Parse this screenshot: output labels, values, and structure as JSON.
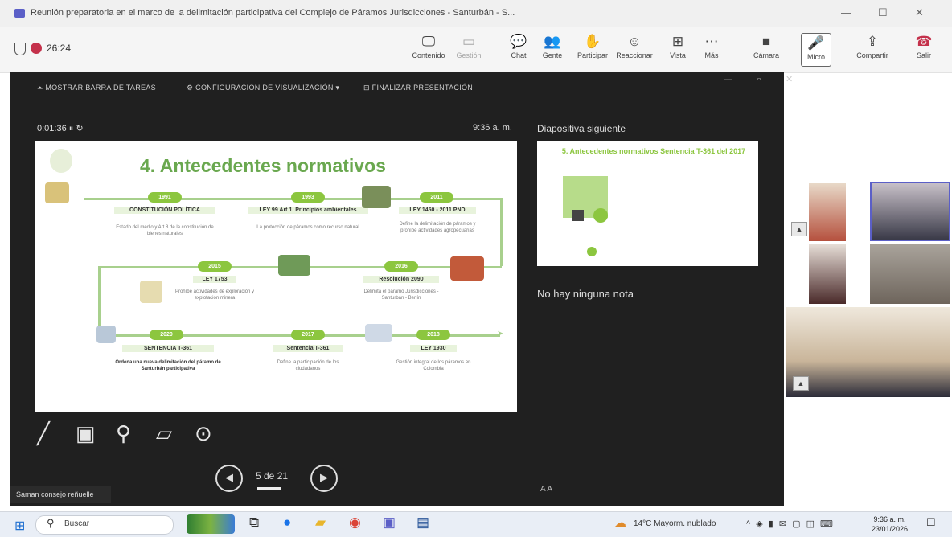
{
  "window": {
    "title": "Reunión preparatoria en el marco de la delimitación participativa del Complejo de Páramos Jurisdicciones - Santurbán - S...",
    "min": "—",
    "max": "☐",
    "close": "✕"
  },
  "toolbar": {
    "timer": "26:24",
    "buttons": [
      {
        "icon": "🖵",
        "label": "Contenido"
      },
      {
        "icon": "▭",
        "label": "Gestión"
      },
      {
        "icon": "💬",
        "label": "Chat"
      },
      {
        "icon": "👥",
        "label": "Gente"
      },
      {
        "icon": "✋",
        "label": "Participar"
      },
      {
        "icon": "☺",
        "label": "Reaccionar"
      },
      {
        "icon": "⊞",
        "label": "Vista"
      },
      {
        "icon": "⋯",
        "label": "Más"
      },
      {
        "icon": "■",
        "label": "Cámara"
      },
      {
        "icon": "🎤",
        "label": "Micro"
      },
      {
        "icon": "⇪",
        "label": "Compartir"
      },
      {
        "icon": "☎",
        "label": "Salir"
      }
    ]
  },
  "presenter": {
    "top_items": [
      "MOSTRAR BARRA DE TAREAS",
      "CONFIGURACIÓN DE VISUALIZACIÓN ▾",
      "FINALIZAR PRESENTACIÓN"
    ],
    "elapsed": "0:01:36",
    "clock": "9:36 a. m.",
    "next_label": "Diapositiva siguiente",
    "notes": "No hay ninguna nota",
    "counter": "5 de 21",
    "toast": "Saman consejo reñuelle"
  },
  "slide": {
    "title": "4. Antecedentes normativos",
    "row1": [
      {
        "year": "1991",
        "label": "CONSTITUCIÓN POLÍTICA",
        "desc": "Estado del medio y Art 8 de la constitución de bienes naturales"
      },
      {
        "year": "1993",
        "label": "LEY 99 Art 1. Principios ambientales",
        "desc": "La protección de páramos como recurso natural"
      },
      {
        "year": "2011",
        "label": "LEY 1450 - 2011 PND",
        "desc": "Define la delimitación de páramos y prohíbe actividades agropecuarias"
      }
    ],
    "row2": [
      {
        "year": "2015",
        "label": "LEY 1753",
        "desc": "Prohíbe actividades de exploración y explotación minera"
      },
      {
        "year": "2016",
        "label": "Resolución 2090",
        "desc": "Delimita el páramo Jurisdicciones - Santurbán - Berlín"
      }
    ],
    "row3": [
      {
        "year": "2020",
        "label": "SENTENCIA T-361",
        "desc": "Ordena una nueva delimitación del páramo de Santurbán participativa"
      },
      {
        "year": "2017",
        "label": "Sentencia T-361",
        "desc": "Define la participación de los ciudadanos"
      },
      {
        "year": "2018",
        "label": "LEY 1930",
        "desc": "Gestión integral de los páramos en Colombia"
      }
    ]
  },
  "next_slide": {
    "title": "5. Antecedentes normativos Sentencia T-361 del 2017"
  },
  "taskbar": {
    "search_placeholder": "Buscar",
    "weather": "14°C  Mayorm. nublado",
    "time": "9:36 a. m.",
    "date": "23/01/2026"
  }
}
